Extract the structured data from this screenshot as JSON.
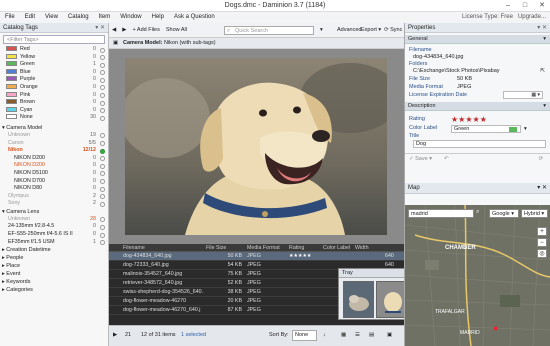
{
  "window": {
    "title": "Dogs.dmc - Daminion 3.7 (1184)",
    "minimize": "–",
    "maximize": "□",
    "close": "✕"
  },
  "menu": {
    "items": [
      "File",
      "Edit",
      "View",
      "Catalog",
      "Item",
      "Window",
      "Help",
      "Ask a Question"
    ],
    "license": "License Type: Free",
    "upgrade": "Upgrade..."
  },
  "catalog_tags": {
    "title": "Catalog Tags",
    "filter_placeholder": "<Filter Tags>",
    "colors": [
      {
        "label": "Red",
        "count": "0",
        "swatch": "#d9534f"
      },
      {
        "label": "Yellow",
        "count": "0",
        "swatch": "#f2e34c"
      },
      {
        "label": "Green",
        "count": "1",
        "swatch": "#5cb85c"
      },
      {
        "label": "Blue",
        "count": "0",
        "swatch": "#4f7fd9"
      },
      {
        "label": "Purple",
        "count": "0",
        "swatch": "#9b59b6"
      },
      {
        "label": "Orange",
        "count": "0",
        "swatch": "#f0ad4e"
      },
      {
        "label": "Pink",
        "count": "0",
        "swatch": "#f7a6c9"
      },
      {
        "label": "Brown",
        "count": "0",
        "swatch": "#8b5a2b"
      },
      {
        "label": "Cyan",
        "count": "0",
        "swatch": "#5bd5e6"
      },
      {
        "label": "None",
        "count": "30",
        "swatch": "#ffffff"
      }
    ],
    "camera_model": {
      "label": "Camera Model",
      "items": [
        {
          "label": "Unknown",
          "count": "19"
        },
        {
          "label": "Canon",
          "count": "5/5"
        },
        {
          "label": "Nikon",
          "count": "12/12"
        },
        {
          "label": "NIKON D200",
          "count": "0"
        },
        {
          "label": "NIKON D200",
          "count": "0"
        },
        {
          "label": "NIKON D5100",
          "count": "0"
        },
        {
          "label": "NIKON D700",
          "count": "0"
        },
        {
          "label": "NIKON D80",
          "count": "0"
        },
        {
          "label": "Olympus",
          "count": "2"
        },
        {
          "label": "Sony",
          "count": "2"
        }
      ]
    },
    "camera_lens": {
      "label": "Camera Lens",
      "items": [
        {
          "label": "Unknown",
          "count": "28"
        },
        {
          "label": "24-135mm f/2.8-4.5",
          "count": "0"
        },
        {
          "label": "EF-S55-250mm f/4-5.6 IS II",
          "count": "0"
        },
        {
          "label": "EF35mm f/1.5 USM",
          "count": "1"
        }
      ]
    },
    "groups": [
      "Creation Datetime",
      "People",
      "Place",
      "Event",
      "Keywords",
      "Categories"
    ]
  },
  "toolbar": {
    "add_files": "Add Files",
    "show_all": "Show All",
    "search_placeholder": "Quick Search",
    "advanced": "Advanced",
    "export": "Export",
    "sync": "Sync"
  },
  "breadcrumb": {
    "label": "Camera Model:",
    "value": "Nikon (with sub-tags)"
  },
  "table": {
    "columns": [
      "Filename",
      "File Size",
      "Media Format",
      "Rating",
      "Color Label",
      "Width"
    ],
    "rows": [
      {
        "filename": "dog-434834_640.jpg",
        "size": "50 KB",
        "format": "JPEG",
        "rating": "★★★★★",
        "label": "",
        "width": "640",
        "selected": true
      },
      {
        "filename": "dog-72333_640.jpg",
        "size": "54 KB",
        "format": "JPEG",
        "rating": "",
        "label": "",
        "width": "640",
        "selected": false
      },
      {
        "filename": "malinois-354527_640.jpg",
        "size": "75 KB",
        "format": "JPEG",
        "rating": "",
        "label": "",
        "width": "640",
        "selected": false
      },
      {
        "filename": "retriever-348572_640.jpg",
        "size": "52 KB",
        "format": "JPEG",
        "rating": "",
        "label": "",
        "width": "640",
        "selected": false
      },
      {
        "filename": "swiss-shepherd-dog-354526_640.j",
        "size": "38 KB",
        "format": "JPEG",
        "rating": "",
        "label": "",
        "width": "640",
        "selected": false
      },
      {
        "filename": "dog-flower-meadow-46270",
        "size": "20 KB",
        "format": "JPEG",
        "rating": "",
        "label": "",
        "width": "640",
        "selected": false
      },
      {
        "filename": "dog-flower-meadow-46270_640.j",
        "size": "87 KB",
        "format": "JPEG",
        "rating": "",
        "label": "",
        "width": "640",
        "selected": false
      }
    ]
  },
  "status": {
    "page": "21",
    "count": "12 of 31 items",
    "selected": "1 selected",
    "sort_label": "Sort By:",
    "sort_value": "None"
  },
  "tray": {
    "title": "Tray"
  },
  "properties": {
    "title": "Properties",
    "general": "General",
    "filename_label": "Filename",
    "filename": "dog-434834_640.jpg",
    "folders_label": "Folders",
    "folder": "C:\\Exchange\\Stock Photos\\Pixabay",
    "filesize_label": "File Size",
    "filesize": "50 KB",
    "format_label": "Media Format",
    "format": "JPEG",
    "license_label": "License Expiration Date",
    "description": "Description",
    "rating_label": "Rating",
    "rating": "★★★★★",
    "rating_value": 5,
    "colorlabel_label": "Color Label",
    "colorlabel": "Green",
    "title_label": "Title",
    "title_value": "Dog",
    "save": "Save"
  },
  "map": {
    "title": "Map",
    "search": "madrid",
    "provider": "Google",
    "mode": "Hybrid",
    "place": "CHAMBER",
    "place2": "TRAFALGAR",
    "place3": "MADRID"
  }
}
